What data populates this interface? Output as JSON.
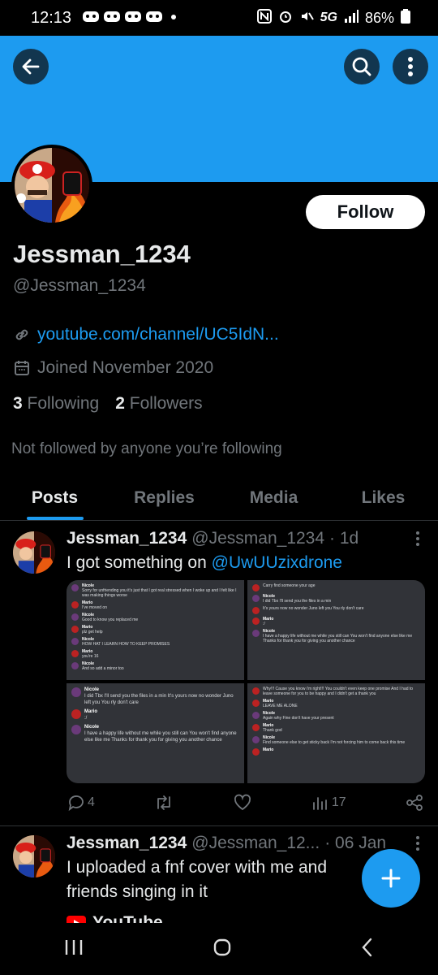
{
  "status_bar": {
    "time": "12:13",
    "notification_icons": "•",
    "network": "5G",
    "battery": "86%"
  },
  "profile": {
    "display_name": "Jessman_1234",
    "handle": "@Jessman_1234",
    "follow_label": "Follow",
    "link": "youtube.com/channel/UC5IdN...",
    "joined": "Joined November 2020",
    "following_count": "3",
    "following_label": "Following",
    "followers_count": "2",
    "followers_label": "Followers",
    "not_followed_text": "Not followed by anyone you’re following"
  },
  "tabs": [
    {
      "label": "Posts",
      "active": true
    },
    {
      "label": "Replies",
      "active": false
    },
    {
      "label": "Media",
      "active": false
    },
    {
      "label": "Likes",
      "active": false
    }
  ],
  "posts": [
    {
      "name": "Jessman_1234",
      "handle": "@Jessman_1234",
      "time": "· 1d",
      "text": "I got something on ",
      "mention": "@UwUUzixdrone",
      "replies": "4",
      "views": "17",
      "media_chats": {
        "tl": [
          {
            "name": "Nicole",
            "text": "Sorry for unfriending you it's just that I got real stressed when I woke up and I felt like I was making things worse"
          },
          {
            "name": "Mario",
            "text": "I've moved on"
          },
          {
            "name": "Nicole",
            "text": "Good to know you replaced me"
          },
          {
            "name": "Mario",
            "text": "plz get help"
          },
          {
            "name": "Nicole",
            "text": "HOW HAT I LEARN HOW TO KEEP PROMISES"
          },
          {
            "name": "Mario",
            "text": "you're 16"
          },
          {
            "name": "Nicole",
            "text": "And so add a minor too"
          }
        ],
        "tr": [
          {
            "name": "",
            "text": "Carry find someone your age"
          },
          {
            "name": "Nicole",
            "text": "I did  Tbx  I'll send you the files in a min"
          },
          {
            "name": "",
            "text": "It's yours now no wonder Juno left you  You rly don't care"
          },
          {
            "name": "Mario",
            "text": ":/"
          },
          {
            "name": "Nicole",
            "text": "I have a happy life without me while you still can  You won't find anyone else like me  Thanks for thank you for giving you another chance"
          }
        ],
        "bl": [
          {
            "name": "Nicole",
            "text": "I did  Tbx  I'll send you the files in a min  It's yours now no wonder Juno left you  You rly don't care"
          },
          {
            "name": "Mario",
            "text": ":/"
          },
          {
            "name": "Nicole",
            "text": "I have a happy life without me while you still can  You won't find anyone else like me  Thanks for thank you for giving you another chance"
          }
        ],
        "br": [
          {
            "name": "",
            "text": "Why!!!  Cause you know i'm right!!!  You couldn't even keep one promise  And I had to leave someone for you to be happy and I didn't get a thank you"
          },
          {
            "name": "Mario",
            "text": "LEAVE ME ALONE"
          },
          {
            "name": "Nicole",
            "text": "Again why  Fine don't have your present"
          },
          {
            "name": "Mario",
            "text": "Thank god"
          },
          {
            "name": "Nicole",
            "text": "Find someone else to get sticky back I'm not forcing him to come back this time"
          },
          {
            "name": "Mario",
            "text": ""
          }
        ]
      }
    },
    {
      "name": "Jessman_1234",
      "handle": "@Jessman_12...",
      "time": "· 06 Jan",
      "text": "I uploaded a fnf cover with me and friends singing in it",
      "card_label": "YouTube"
    }
  ],
  "colors": {
    "accent": "#1d9bf0",
    "background": "#000000",
    "muted": "#71767b",
    "text": "#e7e9ea"
  }
}
